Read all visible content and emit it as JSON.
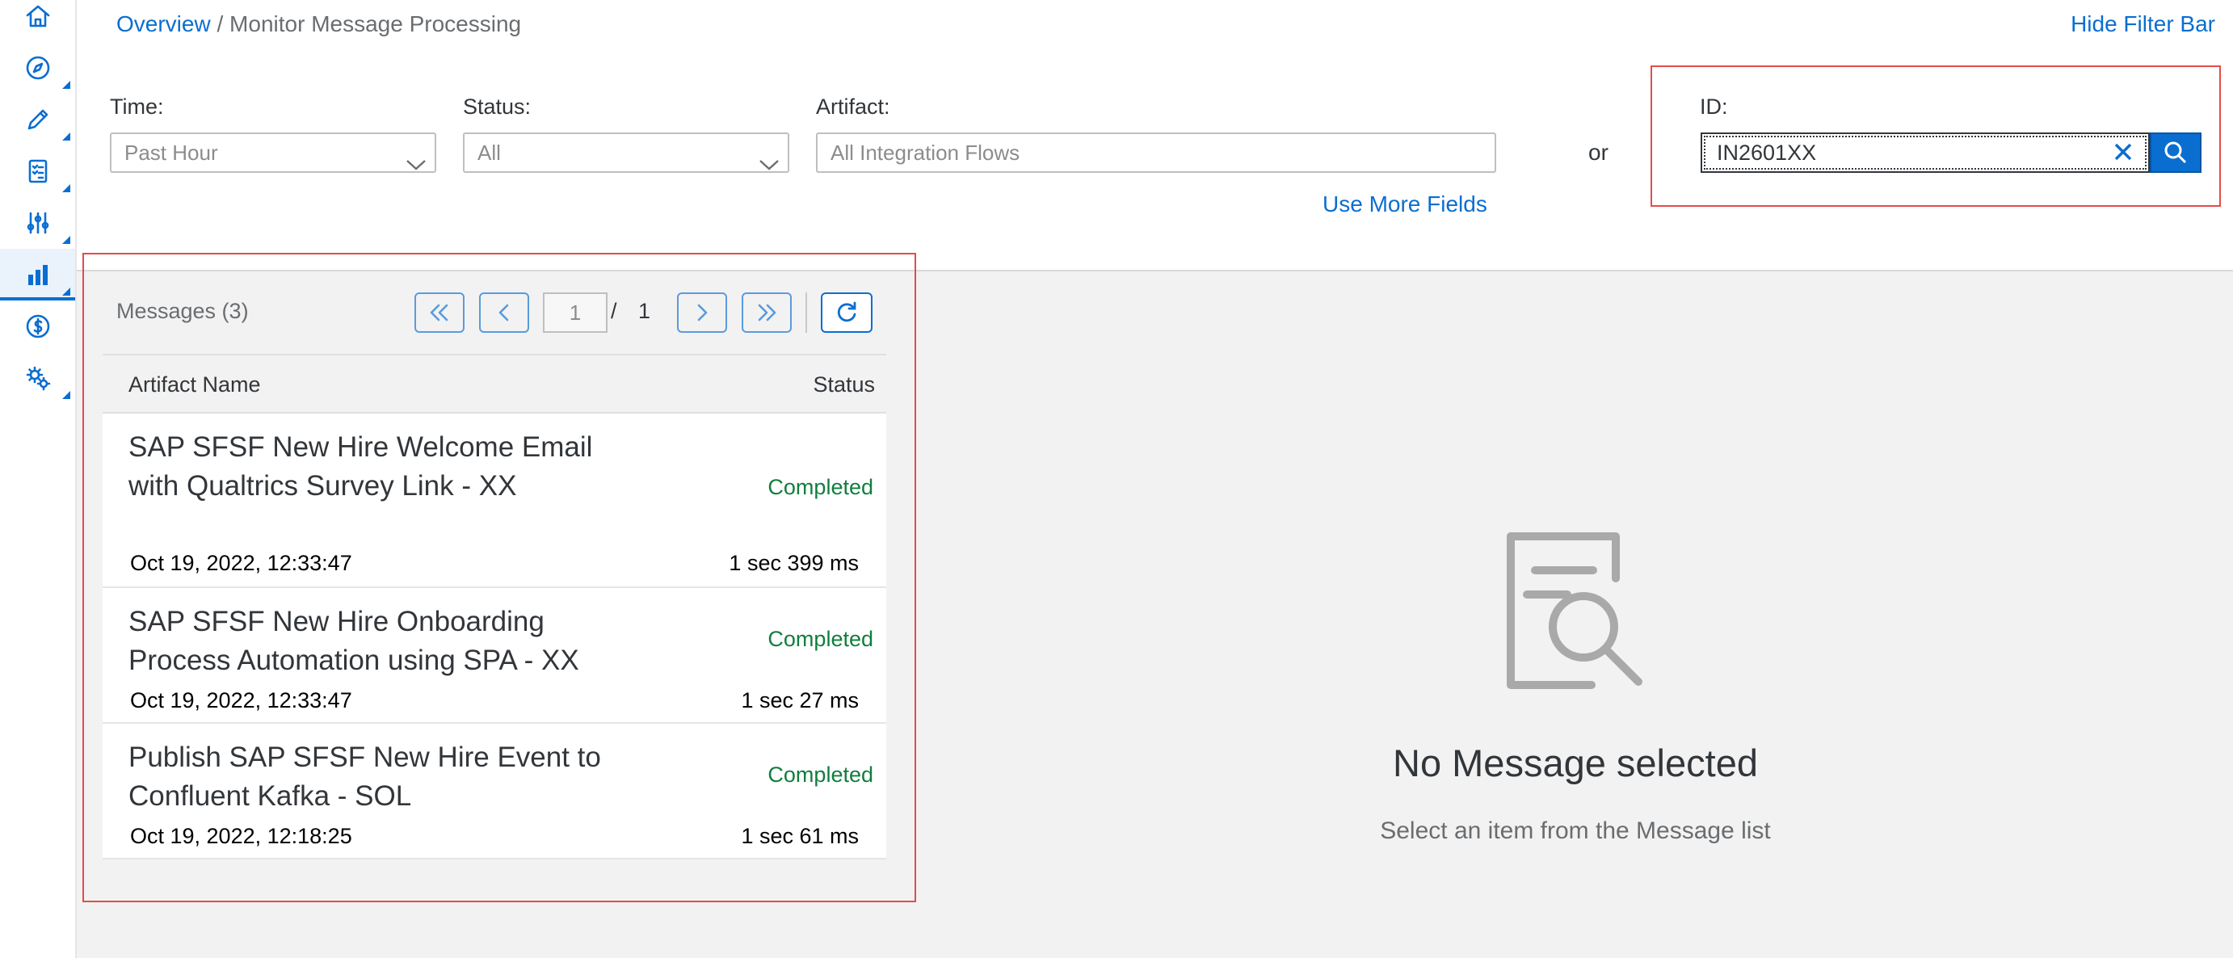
{
  "colors": {
    "accent": "#0a6ed1",
    "success": "#107e3e",
    "highlight_border": "#e34b4b"
  },
  "nav": {
    "items": [
      {
        "name": "home",
        "icon": "home-icon"
      },
      {
        "name": "discover",
        "icon": "compass-icon"
      },
      {
        "name": "design",
        "icon": "pencil-icon"
      },
      {
        "name": "monitor-checklist",
        "icon": "checklist-icon"
      },
      {
        "name": "settings-sliders",
        "icon": "sliders-icon"
      },
      {
        "name": "monitor",
        "icon": "bar-chart-icon",
        "active": true
      },
      {
        "name": "billing",
        "icon": "dollar-icon"
      },
      {
        "name": "settings",
        "icon": "gears-icon"
      }
    ]
  },
  "header": {
    "breadcrumb_link": "Overview",
    "breadcrumb_sep": " / ",
    "breadcrumb_current": "Monitor Message Processing",
    "hide_filter_bar": "Hide Filter Bar"
  },
  "filters": {
    "time_label": "Time:",
    "time_value": "Past Hour",
    "status_label": "Status:",
    "status_value": "All",
    "artifact_label": "Artifact:",
    "artifact_placeholder": "All Integration Flows",
    "or_label": "or",
    "use_more_fields": "Use More Fields",
    "id_label": "ID:",
    "id_value": "IN2601XX"
  },
  "messages": {
    "count_label": "Messages (3)",
    "page_current": "1",
    "page_sep": "/",
    "page_total": "1",
    "columns": {
      "artifact": "Artifact Name",
      "status": "Status"
    },
    "rows": [
      {
        "name": "SAP SFSF New Hire Welcome Email with Qualtrics Survey Link - XX",
        "status": "Completed",
        "date": "Oct 19, 2022, 12:33:47",
        "duration": "1 sec 399 ms"
      },
      {
        "name": "SAP SFSF New Hire Onboarding Process Automation using SPA - XX",
        "status": "Completed",
        "date": "Oct 19, 2022, 12:33:47",
        "duration": "1 sec 27 ms"
      },
      {
        "name": "Publish SAP SFSF New Hire Event to Confluent Kafka - SOL",
        "status": "Completed",
        "date": "Oct 19, 2022, 12:18:25",
        "duration": "1 sec 61 ms"
      }
    ]
  },
  "empty_state": {
    "title": "No Message selected",
    "subtitle": "Select an item from the Message list",
    "icon": "document-search-icon"
  }
}
